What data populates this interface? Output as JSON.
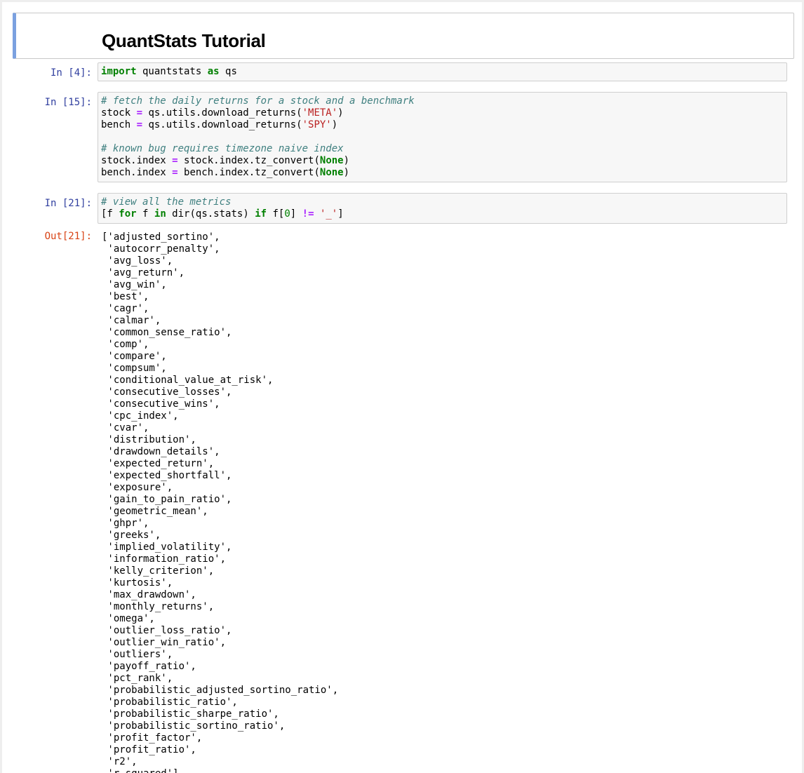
{
  "notebook": {
    "title": "QuantStats Tutorial",
    "cells": [
      {
        "prompt": "In [4]:",
        "lines": [
          [
            {
              "t": "kw",
              "v": "import"
            },
            {
              "t": "",
              "v": " quantstats "
            },
            {
              "t": "kw",
              "v": "as"
            },
            {
              "t": "",
              "v": " qs"
            }
          ]
        ]
      },
      {
        "prompt": "In [15]:",
        "lines": [
          [
            {
              "t": "cm",
              "v": "# fetch the daily returns for a stock and a benchmark"
            }
          ],
          [
            {
              "t": "",
              "v": "stock "
            },
            {
              "t": "op",
              "v": "="
            },
            {
              "t": "",
              "v": " qs.utils.download_returns("
            },
            {
              "t": "str",
              "v": "'META'"
            },
            {
              "t": "",
              "v": ")"
            }
          ],
          [
            {
              "t": "",
              "v": "bench "
            },
            {
              "t": "op",
              "v": "="
            },
            {
              "t": "",
              "v": " qs.utils.download_returns("
            },
            {
              "t": "str",
              "v": "'SPY'"
            },
            {
              "t": "",
              "v": ")"
            }
          ],
          [],
          [
            {
              "t": "cm",
              "v": "# known bug requires timezone naive index"
            }
          ],
          [
            {
              "t": "",
              "v": "stock.index "
            },
            {
              "t": "op",
              "v": "="
            },
            {
              "t": "",
              "v": " stock.index.tz_convert("
            },
            {
              "t": "kw",
              "v": "None"
            },
            {
              "t": "",
              "v": ")"
            }
          ],
          [
            {
              "t": "",
              "v": "bench.index "
            },
            {
              "t": "op",
              "v": "="
            },
            {
              "t": "",
              "v": " bench.index.tz_convert("
            },
            {
              "t": "kw",
              "v": "None"
            },
            {
              "t": "",
              "v": ")"
            }
          ]
        ]
      },
      {
        "prompt": "In [21]:",
        "lines": [
          [
            {
              "t": "cm",
              "v": "# view all the metrics"
            }
          ],
          [
            {
              "t": "",
              "v": "[f "
            },
            {
              "t": "kw",
              "v": "for"
            },
            {
              "t": "",
              "v": " f "
            },
            {
              "t": "kw",
              "v": "in"
            },
            {
              "t": "",
              "v": " dir(qs.stats) "
            },
            {
              "t": "kw",
              "v": "if"
            },
            {
              "t": "",
              "v": " f["
            },
            {
              "t": "num",
              "v": "0"
            },
            {
              "t": "",
              "v": "] "
            },
            {
              "t": "op",
              "v": "!="
            },
            {
              "t": "",
              "v": " "
            },
            {
              "t": "str",
              "v": "'_'"
            },
            {
              "t": "",
              "v": "]"
            }
          ]
        ]
      }
    ],
    "output": {
      "prompt": "Out[21]:",
      "items": [
        "adjusted_sortino",
        "autocorr_penalty",
        "avg_loss",
        "avg_return",
        "avg_win",
        "best",
        "cagr",
        "calmar",
        "common_sense_ratio",
        "comp",
        "compare",
        "compsum",
        "conditional_value_at_risk",
        "consecutive_losses",
        "consecutive_wins",
        "cpc_index",
        "cvar",
        "distribution",
        "drawdown_details",
        "expected_return",
        "expected_shortfall",
        "exposure",
        "gain_to_pain_ratio",
        "geometric_mean",
        "ghpr",
        "greeks",
        "implied_volatility",
        "information_ratio",
        "kelly_criterion",
        "kurtosis",
        "max_drawdown",
        "monthly_returns",
        "omega",
        "outlier_loss_ratio",
        "outlier_win_ratio",
        "outliers",
        "payoff_ratio",
        "pct_rank",
        "probabilistic_adjusted_sortino_ratio",
        "probabilistic_ratio",
        "probabilistic_sharpe_ratio",
        "probabilistic_sortino_ratio",
        "profit_factor",
        "profit_ratio",
        "r2",
        "r_squared"
      ]
    }
  }
}
